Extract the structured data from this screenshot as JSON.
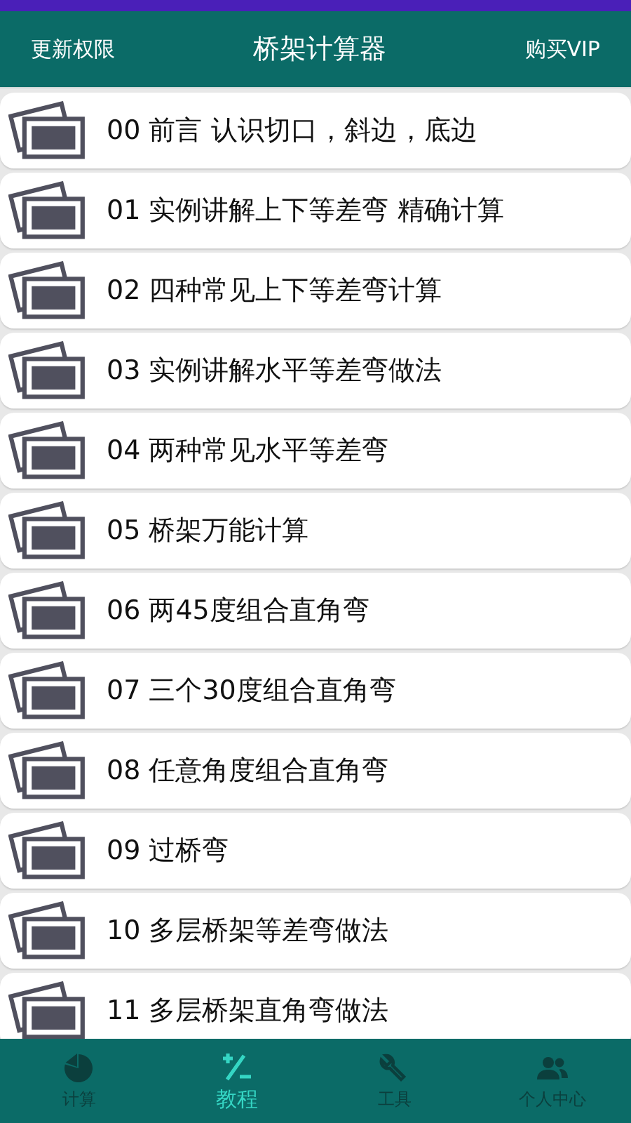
{
  "header": {
    "left_button": "更新权限",
    "title": "桥架计算器",
    "right_button": "购买VIP"
  },
  "lessons": [
    {
      "title": "00 前言 认识切口，斜边，底边"
    },
    {
      "title": "01 实例讲解上下等差弯 精确计算"
    },
    {
      "title": "02 四种常见上下等差弯计算"
    },
    {
      "title": "03 实例讲解水平等差弯做法"
    },
    {
      "title": "04 两种常见水平等差弯"
    },
    {
      "title": "05 桥架万能计算"
    },
    {
      "title": "06 两45度组合直角弯"
    },
    {
      "title": "07 三个30度组合直角弯"
    },
    {
      "title": "08 任意角度组合直角弯"
    },
    {
      "title": "09 过桥弯"
    },
    {
      "title": "10 多层桥架等差弯做法"
    },
    {
      "title": "11 多层桥架直角弯做法"
    }
  ],
  "bottom_nav": [
    {
      "label": "计算",
      "kind": "pie",
      "selected": false
    },
    {
      "label": "教程",
      "kind": "plusminus",
      "selected": true
    },
    {
      "label": "工具",
      "kind": "wrench",
      "selected": false
    },
    {
      "label": "个人中心",
      "kind": "people",
      "selected": false
    }
  ]
}
